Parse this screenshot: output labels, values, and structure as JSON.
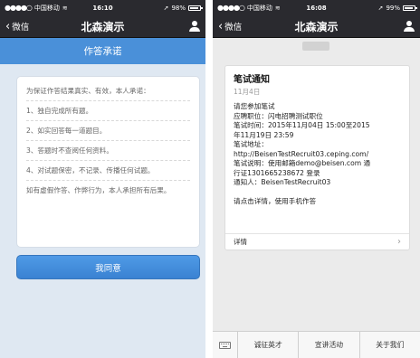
{
  "left": {
    "status": {
      "carrier": "中国移动",
      "time": "16:10",
      "battery": "98%"
    },
    "nav": {
      "back_label": "微信",
      "title": "北森演示"
    },
    "header": "作答承诺",
    "promise_lines": [
      "为保证作答结果真实、有效，本人承诺：",
      "1、独自完成所有题。",
      "2、如实回答每一道题目。",
      "3、答题时不查阅任何资料。",
      "4、对试题保密，不记录、传播任何试题。",
      "如有虚假作答、作弊行为，本人承担所有后果。"
    ],
    "agree_button": "我同意"
  },
  "right": {
    "status": {
      "carrier": "中国移动",
      "time": "16:08",
      "battery": "99%"
    },
    "nav": {
      "back_label": "微信",
      "title": "北森演示"
    },
    "notice": {
      "title": "笔试通知",
      "date": "11月4日",
      "lines": [
        "请您参加笔试",
        "应聘职位：闪电招聘测试职位",
        "笔试时间：2015年11月04日 15:00至2015",
        "年11月19日 23:59",
        "笔试地址：",
        "http://BeisenTestRecruit03.ceping.com/",
        "笔试说明：使用邮箱demo@beisen.com 通",
        "行证1301665238672 登录",
        "通知人：BeisenTestRecruit03"
      ],
      "cta": "请点击详情，使用手机作答",
      "footer_label": "详情"
    },
    "menu": [
      "诚征英才",
      "宣讲活动",
      "关于我们"
    ]
  }
}
